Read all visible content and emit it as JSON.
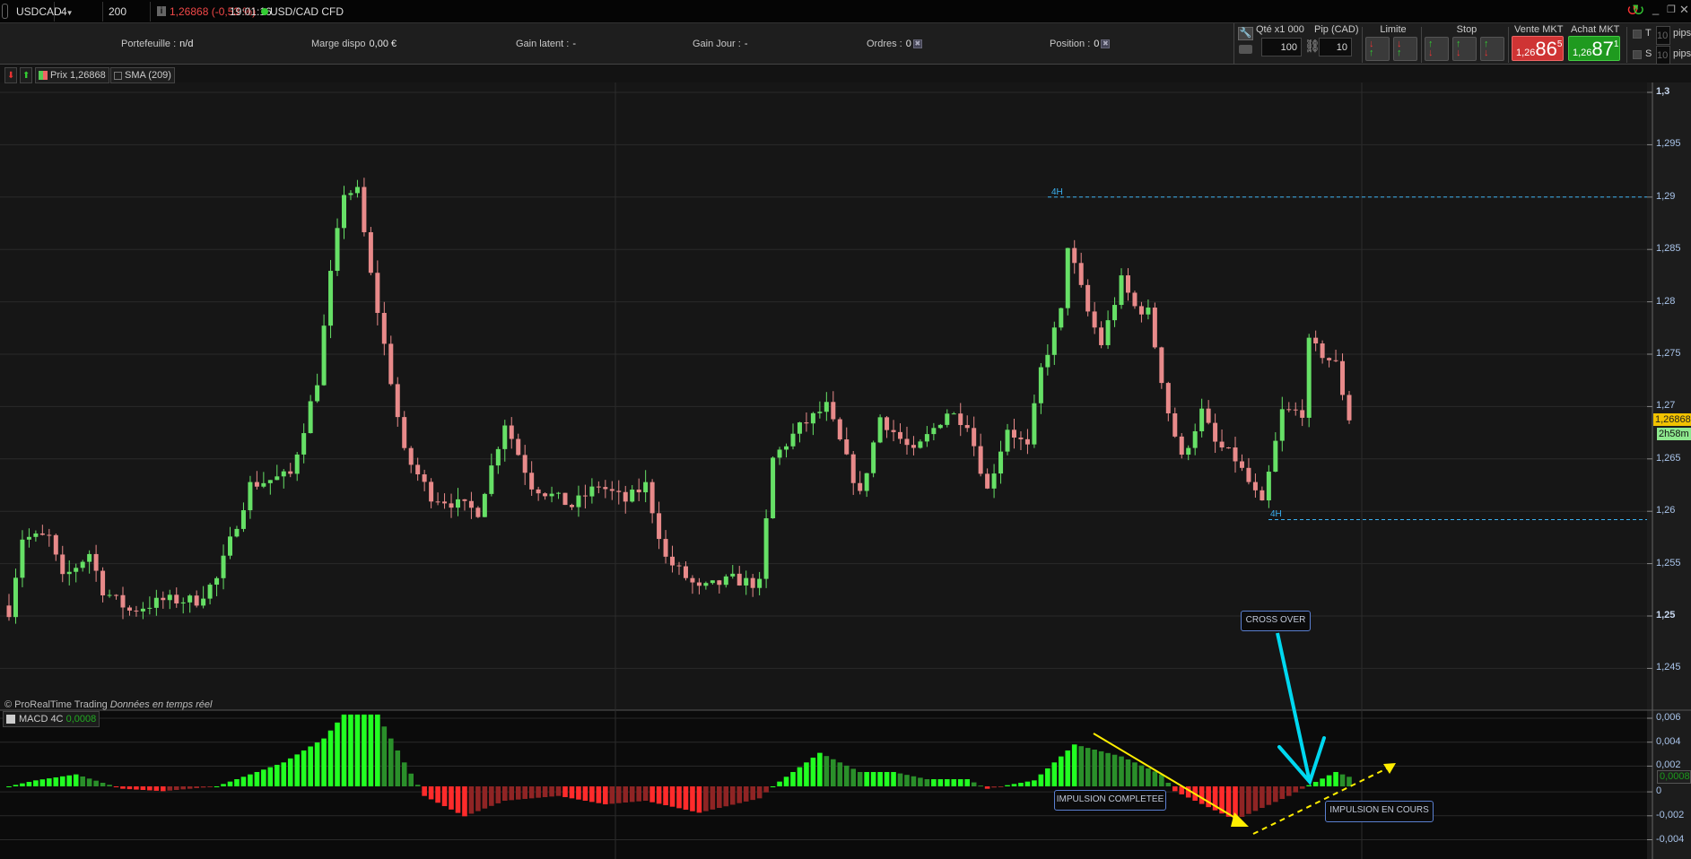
{
  "topbar": {
    "symbol": "USDCAD",
    "timeframe": "4 heures",
    "units": "200 unités",
    "price_change": "1,26868 (-0,53 %)",
    "time": "19:01:16",
    "instrument": "USD/CAD CFD"
  },
  "account": {
    "portefeuille_label": "Portefeuille :",
    "portefeuille": "n/d",
    "marge_label": "Marge dispo",
    "marge": "0,00 €",
    "gain_latent_label": "Gain latent :",
    "gain_latent": "-",
    "gain_jour_label": "Gain Jour :",
    "gain_jour": "-",
    "ordres_label": "Ordres :",
    "ordres": "0",
    "position_label": "Position :",
    "position": "0"
  },
  "order_panel": {
    "qty_label": "Qté x1 000",
    "qty": "100",
    "pip_label": "Pip (CAD)",
    "pip": "10",
    "limit_label": "Limite",
    "stop_label": "Stop",
    "sell_label": "Vente MKT",
    "sell_prefix": "1,26",
    "sell_big": "86",
    "sell_exp": "5",
    "buy_label": "Achat MKT",
    "buy_prefix": "1,26",
    "buy_big": "87",
    "buy_exp": "1",
    "t_label": "T",
    "t_value": "10",
    "s_label": "S",
    "s_value": "10",
    "pips": "pips"
  },
  "legend": {
    "price": "Prix 1,26868",
    "sma": "SMA (209)"
  },
  "footer": {
    "copyright": "© ProRealTime Trading",
    "realtime": "Données en temps réel"
  },
  "macd_legend": {
    "name": "MACD 4C",
    "value": "0,0008"
  },
  "annotations": {
    "cross_over": "CROSS OVER",
    "impulse_done": "IMPULSION COMPLETEE",
    "impulse_now": "IMPULSION EN COURS",
    "level_high": "4H",
    "level_low": "4H"
  },
  "colors": {
    "up": "#66e066",
    "down": "#e88a8a",
    "macd_up_strong": "#22ff22",
    "macd_up_weak": "#2a8f2a",
    "macd_down_strong": "#ff2b2b",
    "macd_down_weak": "#8f2424",
    "accent_cyan": "#00d8f0",
    "accent_yellow": "#ffee00"
  },
  "chart_data": {
    "type": "candlestick",
    "candles": 201,
    "price_axis": {
      "ticks": [
        "1,3",
        "1,295",
        "1,29",
        "1,285",
        "1,28",
        "1,275",
        "1,27",
        "1,265",
        "1,26",
        "1,255",
        "1,25",
        "1,245"
      ],
      "min": 1.2425,
      "max": 1.3015
    },
    "last_price": "1,26868",
    "countdown": "2h58m",
    "levels": [
      1.29,
      1.2592
    ],
    "close_keypoints": [
      [
        0,
        1.2505
      ],
      [
        2,
        1.2575
      ],
      [
        6,
        1.2575
      ],
      [
        8,
        1.2535
      ],
      [
        12,
        1.256
      ],
      [
        14,
        1.2525
      ],
      [
        18,
        1.2505
      ],
      [
        23,
        1.2515
      ],
      [
        28,
        1.2515
      ],
      [
        31,
        1.2535
      ],
      [
        36,
        1.2625
      ],
      [
        42,
        1.2635
      ],
      [
        46,
        1.2725
      ],
      [
        48,
        1.2825
      ],
      [
        50,
        1.2905
      ],
      [
        52,
        1.2905
      ],
      [
        54,
        1.2825
      ],
      [
        57,
        1.2725
      ],
      [
        59,
        1.2655
      ],
      [
        63,
        1.2615
      ],
      [
        70,
        1.26
      ],
      [
        74,
        1.2685
      ],
      [
        78,
        1.2625
      ],
      [
        84,
        1.2605
      ],
      [
        88,
        1.2625
      ],
      [
        92,
        1.261
      ],
      [
        95,
        1.2625
      ],
      [
        98,
        1.2555
      ],
      [
        103,
        1.2525
      ],
      [
        108,
        1.2535
      ],
      [
        112,
        1.253
      ],
      [
        114,
        1.265
      ],
      [
        118,
        1.268
      ],
      [
        122,
        1.27
      ],
      [
        127,
        1.2615
      ],
      [
        130,
        1.269
      ],
      [
        135,
        1.2655
      ],
      [
        140,
        1.2695
      ],
      [
        143,
        1.2685
      ],
      [
        146,
        1.262
      ],
      [
        149,
        1.268
      ],
      [
        152,
        1.266
      ],
      [
        154,
        1.2735
      ],
      [
        157,
        1.279
      ],
      [
        158,
        1.2855
      ],
      [
        161,
        1.279
      ],
      [
        163,
        1.276
      ],
      [
        166,
        1.282
      ],
      [
        168,
        1.2795
      ],
      [
        170,
        1.279
      ],
      [
        173,
        1.2695
      ],
      [
        175,
        1.265
      ],
      [
        178,
        1.2695
      ],
      [
        180,
        1.2665
      ],
      [
        183,
        1.265
      ],
      [
        187,
        1.2605
      ],
      [
        190,
        1.2695
      ],
      [
        193,
        1.2695
      ],
      [
        194,
        1.276
      ],
      [
        198,
        1.274
      ],
      [
        200,
        1.26868
      ]
    ],
    "macd_axis": {
      "ticks": [
        "0,006",
        "0,004",
        "0,002",
        "0",
        "-0,002",
        "-0,004"
      ]
    },
    "macd_keypoints": [
      [
        0,
        0
      ],
      [
        4,
        0.0005
      ],
      [
        10,
        0.001
      ],
      [
        14,
        0.0003
      ],
      [
        17,
        -0.0002
      ],
      [
        23,
        -0.0004
      ],
      [
        31,
        0
      ],
      [
        41,
        0.002
      ],
      [
        47,
        0.004
      ],
      [
        50,
        0.006
      ],
      [
        55,
        0.006
      ],
      [
        59,
        0.002
      ],
      [
        62,
        -0.0008
      ],
      [
        68,
        -0.0025
      ],
      [
        74,
        -0.0012
      ],
      [
        82,
        -0.0008
      ],
      [
        89,
        -0.0015
      ],
      [
        95,
        -0.0012
      ],
      [
        103,
        -0.0022
      ],
      [
        112,
        -0.001
      ],
      [
        114,
        0
      ],
      [
        121,
        0.0028
      ],
      [
        127,
        0.0012
      ],
      [
        132,
        0.0012
      ],
      [
        137,
        0.0006
      ],
      [
        143,
        0.0006
      ],
      [
        146,
        -0.0002
      ],
      [
        153,
        0.0005
      ],
      [
        159,
        0.0035
      ],
      [
        166,
        0.0025
      ],
      [
        172,
        0.001
      ],
      [
        174,
        -0.0004
      ],
      [
        183,
        -0.0028
      ],
      [
        191,
        -0.0008
      ],
      [
        194,
        0.0001
      ],
      [
        198,
        0.0012
      ],
      [
        200,
        0.0008
      ]
    ]
  }
}
